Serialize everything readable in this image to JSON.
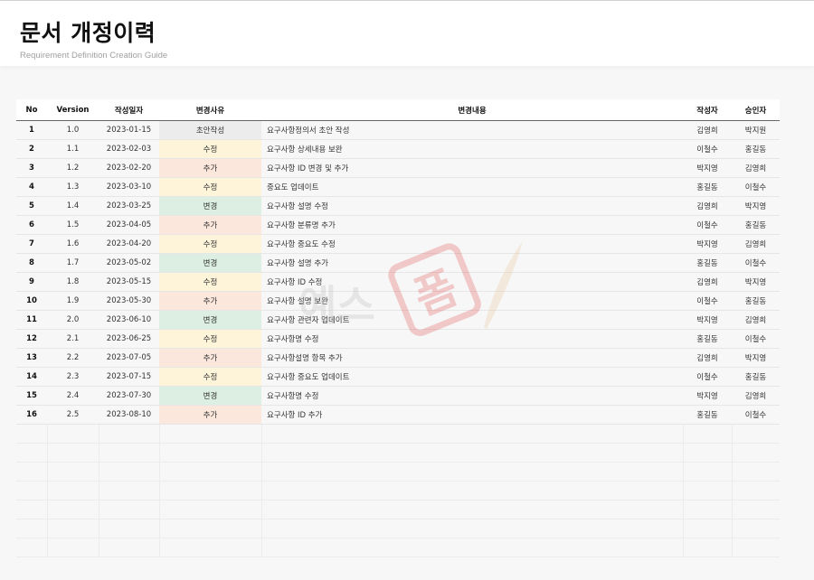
{
  "document": {
    "title": "문서 개정이력",
    "subtitle": "Requirement Definition Creation Guide"
  },
  "table": {
    "headers": [
      "No",
      "Version",
      "작성일자",
      "변경사유",
      "변경내용",
      "작성자",
      "승인자"
    ],
    "rows": [
      {
        "no": "1",
        "version": "1.0",
        "date": "2023-01-15",
        "reason": "초안작성",
        "content": "요구사항정의서 초안 작성",
        "author": "김영희",
        "approver": "박지원"
      },
      {
        "no": "2",
        "version": "1.1",
        "date": "2023-02-03",
        "reason": "수정",
        "content": "요구사항 상세내용 보완",
        "author": "이철수",
        "approver": "홍길동"
      },
      {
        "no": "3",
        "version": "1.2",
        "date": "2023-02-20",
        "reason": "추가",
        "content": "요구사항 ID 변경 및 추가",
        "author": "박지영",
        "approver": "김영희"
      },
      {
        "no": "4",
        "version": "1.3",
        "date": "2023-03-10",
        "reason": "수정",
        "content": "중요도 업데이트",
        "author": "홍길동",
        "approver": "이철수"
      },
      {
        "no": "5",
        "version": "1.4",
        "date": "2023-03-25",
        "reason": "변경",
        "content": "요구사항 설명 수정",
        "author": "김영희",
        "approver": "박지영"
      },
      {
        "no": "6",
        "version": "1.5",
        "date": "2023-04-05",
        "reason": "추가",
        "content": "요구사항 분류명 추가",
        "author": "이철수",
        "approver": "홍길동"
      },
      {
        "no": "7",
        "version": "1.6",
        "date": "2023-04-20",
        "reason": "수정",
        "content": "요구사항 중요도 수정",
        "author": "박지영",
        "approver": "김영희"
      },
      {
        "no": "8",
        "version": "1.7",
        "date": "2023-05-02",
        "reason": "변경",
        "content": "요구사항 설명 추가",
        "author": "홍길동",
        "approver": "이철수"
      },
      {
        "no": "9",
        "version": "1.8",
        "date": "2023-05-15",
        "reason": "수정",
        "content": "요구사항 ID 수정",
        "author": "김영희",
        "approver": "박지영"
      },
      {
        "no": "10",
        "version": "1.9",
        "date": "2023-05-30",
        "reason": "추가",
        "content": "요구사항 설명 보완",
        "author": "이철수",
        "approver": "홍길동"
      },
      {
        "no": "11",
        "version": "2.0",
        "date": "2023-06-10",
        "reason": "변경",
        "content": "요구사항 관련자 업데이트",
        "author": "박지영",
        "approver": "김영희"
      },
      {
        "no": "12",
        "version": "2.1",
        "date": "2023-06-25",
        "reason": "수정",
        "content": "요구사항명 수정",
        "author": "홍길동",
        "approver": "이철수"
      },
      {
        "no": "13",
        "version": "2.2",
        "date": "2023-07-05",
        "reason": "추가",
        "content": "요구사항설명 항목 추가",
        "author": "김영희",
        "approver": "박지영"
      },
      {
        "no": "14",
        "version": "2.3",
        "date": "2023-07-15",
        "reason": "수정",
        "content": "요구사항 중요도 업데이트",
        "author": "이철수",
        "approver": "홍길동"
      },
      {
        "no": "15",
        "version": "2.4",
        "date": "2023-07-30",
        "reason": "변경",
        "content": "요구사항명 수정",
        "author": "박지영",
        "approver": "김영희"
      },
      {
        "no": "16",
        "version": "2.5",
        "date": "2023-08-10",
        "reason": "추가",
        "content": "요구사항 ID 추가",
        "author": "홍길동",
        "approver": "이철수"
      }
    ],
    "empty_rows": 7
  },
  "reason_colors": {
    "초안작성": "#ececec",
    "수정": "#fdf4d9",
    "추가": "#fbe7dc",
    "변경": "#dcefe2"
  },
  "watermark": {
    "text": "예스폼",
    "icon": "quill-pen-icon",
    "color": "#e05050"
  }
}
